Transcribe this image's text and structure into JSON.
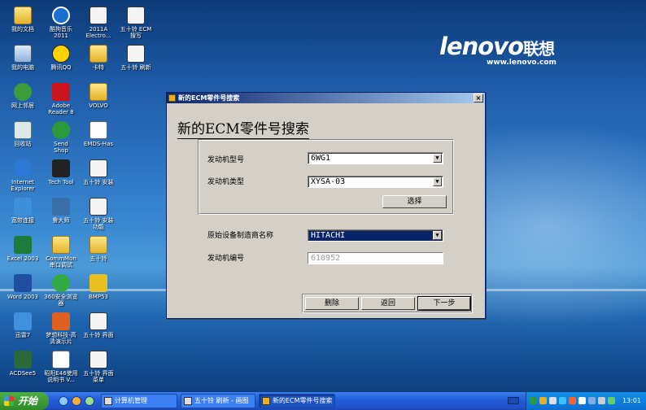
{
  "desktop": {
    "icons": [
      {
        "label": "我的文档",
        "icon": "folder-icon"
      },
      {
        "label": "酷狗音乐\n2011",
        "icon": "music-icon"
      },
      {
        "label": "2011A\nElectro...",
        "icon": "ecm-icon"
      },
      {
        "label": "五十铃 ECM\n搜写",
        "icon": "ecm-icon"
      },
      {
        "label": "我的电脑",
        "icon": "computer-icon"
      },
      {
        "label": "腾讯QQ",
        "icon": "qq-icon"
      },
      {
        "label": "卡特",
        "icon": "folder-icon"
      },
      {
        "label": "五十铃 刷新",
        "icon": "ecm-icon"
      },
      {
        "label": "网上邻居",
        "icon": "network-icon"
      },
      {
        "label": "Adobe\nReader 8",
        "icon": "pdf-icon"
      },
      {
        "label": "VOLVO",
        "icon": "folder-icon"
      },
      {
        "label": "回收站",
        "icon": "recycle-bin-icon"
      },
      {
        "label": "Send\nShop",
        "icon": "send-icon"
      },
      {
        "label": "EMDS-Has",
        "icon": "document-icon"
      },
      {
        "label": "Internet\nExplorer",
        "icon": "ie-icon"
      },
      {
        "label": "Tech Tool",
        "icon": "tool-icon"
      },
      {
        "label": "五十铃 安装",
        "icon": "ecm-icon"
      },
      {
        "label": "宽带连接",
        "icon": "broadband-icon"
      },
      {
        "label": "鲁大师",
        "icon": "ludashi-icon"
      },
      {
        "label": "五十铃 安装\n功能",
        "icon": "ecm-icon"
      },
      {
        "label": "Excel 2003",
        "icon": "excel-icon"
      },
      {
        "label": "CommMon\n串口调试",
        "icon": "folder-icon"
      },
      {
        "label": "五十铃",
        "icon": "folder-icon"
      },
      {
        "label": "Word 2003",
        "icon": "word-icon"
      },
      {
        "label": "360安全浏览\n器",
        "icon": "browser-360-icon"
      },
      {
        "label": "BMP53",
        "icon": "bmp-icon"
      },
      {
        "label": "迅雷7",
        "icon": "xunlei-icon"
      },
      {
        "label": "梦想科技-高\n清演示片",
        "icon": "video-icon"
      },
      {
        "label": "五十铃 界面",
        "icon": "ecm-icon"
      },
      {
        "label": "ACDSee5",
        "icon": "acdsee-icon"
      },
      {
        "label": "昭阳E46使用\n说明书 V...",
        "icon": "document-icon"
      },
      {
        "label": "五十铃 界面\n菜单",
        "icon": "ecm-icon"
      }
    ],
    "logo": {
      "brand": "lenovo",
      "cn": "联想",
      "url": "www.lenovo.com"
    }
  },
  "dialog": {
    "title": "新的ECM零件号搜索",
    "heading": "新的ECM零件号搜索",
    "engine_model_label": "发动机型号",
    "engine_model_value": "6WG1",
    "engine_type_label": "发动机类型",
    "engine_type_value": "XYSA-03",
    "select_button": "选择",
    "oem_label": "原始设备制造商名称",
    "oem_value": "HITACHI",
    "engine_number_label": "发动机编号",
    "engine_number_value": "610952",
    "delete_button": "删除",
    "back_button": "返回",
    "next_button": "下一步",
    "close_glyph": "×"
  },
  "taskbar": {
    "start_label": "开始",
    "tasks": [
      {
        "label": "计算机管理",
        "active": false
      },
      {
        "label": "五十铃 刷新 - 画图",
        "active": false
      },
      {
        "label": "新的ECM零件号搜索",
        "active": true
      }
    ],
    "clock": "13:01"
  }
}
